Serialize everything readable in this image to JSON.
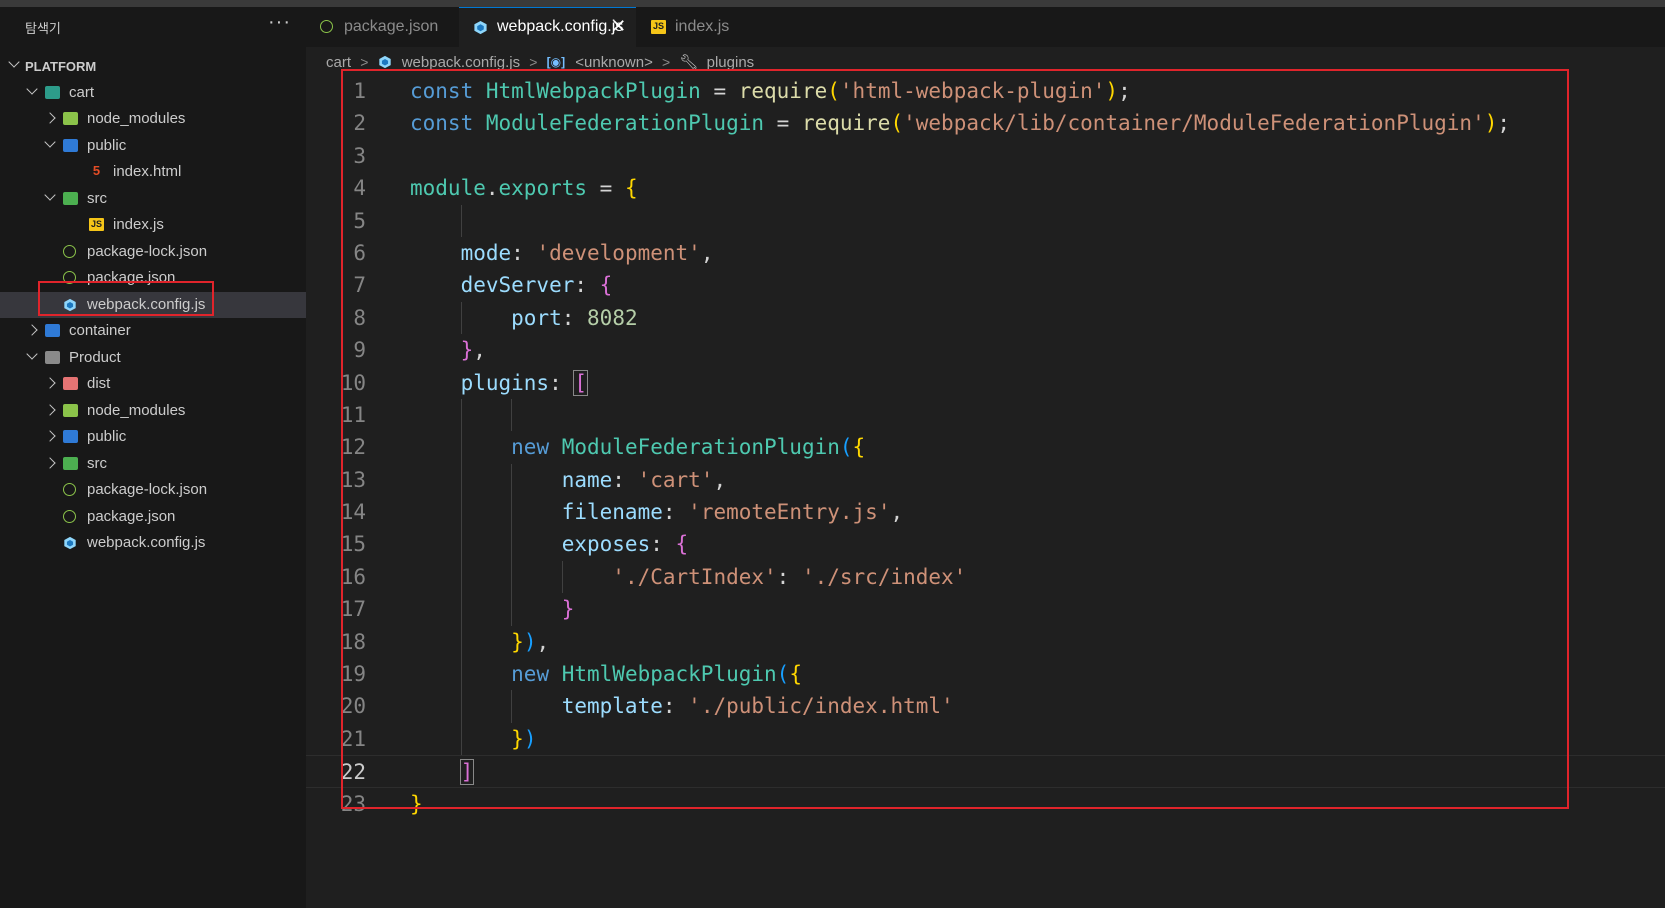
{
  "explorer": {
    "title": "탐색기",
    "more_actions": "···",
    "tree": [
      {
        "label": "PLATFORM",
        "kind": "root",
        "depth": 0,
        "expanded": true
      },
      {
        "label": "cart",
        "kind": "folder-cart",
        "depth": 1,
        "expanded": true
      },
      {
        "label": "node_modules",
        "kind": "folder-node_modules",
        "depth": 2,
        "expanded": false
      },
      {
        "label": "public",
        "kind": "folder-public",
        "depth": 2,
        "expanded": true
      },
      {
        "label": "index.html",
        "kind": "file-html",
        "depth": 3
      },
      {
        "label": "src",
        "kind": "folder-src",
        "depth": 2,
        "expanded": true
      },
      {
        "label": "index.js",
        "kind": "file-js",
        "depth": 3
      },
      {
        "label": "package-lock.json",
        "kind": "file-json",
        "depth": 2
      },
      {
        "label": "package.json",
        "kind": "file-json",
        "depth": 2
      },
      {
        "label": "webpack.config.js",
        "kind": "file-webpack",
        "depth": 2,
        "selected": true
      },
      {
        "label": "container",
        "kind": "folder-container",
        "depth": 1,
        "expanded": false
      },
      {
        "label": "Product",
        "kind": "folder-plain",
        "depth": 1,
        "expanded": true
      },
      {
        "label": "dist",
        "kind": "folder-dist",
        "depth": 2,
        "expanded": false
      },
      {
        "label": "node_modules",
        "kind": "folder-node_modules",
        "depth": 2,
        "expanded": false
      },
      {
        "label": "public",
        "kind": "folder-public",
        "depth": 2,
        "expanded": false
      },
      {
        "label": "src",
        "kind": "folder-src",
        "depth": 2,
        "expanded": false
      },
      {
        "label": "package-lock.json",
        "kind": "file-json",
        "depth": 2
      },
      {
        "label": "package.json",
        "kind": "file-json",
        "depth": 2
      },
      {
        "label": "webpack.config.js",
        "kind": "file-webpack",
        "depth": 2
      }
    ]
  },
  "tabs": [
    {
      "label": "package.json",
      "icon": "json-icon",
      "active": false
    },
    {
      "label": "webpack.config.js",
      "icon": "webpack-icon",
      "active": true,
      "close": "✕"
    },
    {
      "label": "index.js",
      "icon": "js-icon",
      "active": false
    }
  ],
  "breadcrumb": {
    "folder": "cart",
    "file": "webpack.config.js",
    "symbol1": "<unknown>",
    "symbol2": "plugins",
    "separator": ">"
  },
  "editor": {
    "current_line": 22,
    "lines": [
      [
        [
          "kw",
          "const "
        ],
        [
          "cls",
          "HtmlWebpackPlugin"
        ],
        [
          "pl",
          " = "
        ],
        [
          "fn",
          "require"
        ],
        [
          "b1",
          "("
        ],
        [
          "str",
          "'html-webpack-plugin'"
        ],
        [
          "b1",
          ")"
        ],
        [
          "pl",
          ";"
        ]
      ],
      [
        [
          "kw",
          "const "
        ],
        [
          "cls",
          "ModuleFederationPlugin"
        ],
        [
          "pl",
          " = "
        ],
        [
          "fn",
          "require"
        ],
        [
          "b1",
          "("
        ],
        [
          "str",
          "'webpack/lib/container/ModuleFederationPlugin'"
        ],
        [
          "b1",
          ")"
        ],
        [
          "pl",
          ";"
        ]
      ],
      [],
      [
        [
          "cls",
          "module"
        ],
        [
          "pl",
          "."
        ],
        [
          "cls",
          "exports"
        ],
        [
          "pl",
          " = "
        ],
        [
          "b1",
          "{"
        ]
      ],
      [],
      [
        [
          "pl",
          "    "
        ],
        [
          "prop",
          "mode"
        ],
        [
          "pl",
          ": "
        ],
        [
          "str",
          "'development'"
        ],
        [
          "pl",
          ","
        ]
      ],
      [
        [
          "pl",
          "    "
        ],
        [
          "prop",
          "devServer"
        ],
        [
          "pl",
          ": "
        ],
        [
          "b2",
          "{"
        ]
      ],
      [
        [
          "pl",
          "        "
        ],
        [
          "prop",
          "port"
        ],
        [
          "pl",
          ": "
        ],
        [
          "num",
          "8082"
        ]
      ],
      [
        [
          "pl",
          "    "
        ],
        [
          "b2",
          "}"
        ],
        [
          "pl",
          ","
        ]
      ],
      [
        [
          "pl",
          "    "
        ],
        [
          "prop",
          "plugins"
        ],
        [
          "pl",
          ": "
        ],
        [
          "b2",
          "["
        ]
      ],
      [],
      [
        [
          "pl",
          "        "
        ],
        [
          "kw",
          "new "
        ],
        [
          "cls",
          "ModuleFederationPlugin"
        ],
        [
          "b3",
          "("
        ],
        [
          "b1",
          "{"
        ]
      ],
      [
        [
          "pl",
          "            "
        ],
        [
          "prop",
          "name"
        ],
        [
          "pl",
          ": "
        ],
        [
          "str",
          "'cart'"
        ],
        [
          "pl",
          ","
        ]
      ],
      [
        [
          "pl",
          "            "
        ],
        [
          "prop",
          "filename"
        ],
        [
          "pl",
          ": "
        ],
        [
          "str",
          "'remoteEntry.js'"
        ],
        [
          "pl",
          ","
        ]
      ],
      [
        [
          "pl",
          "            "
        ],
        [
          "prop",
          "exposes"
        ],
        [
          "pl",
          ": "
        ],
        [
          "b2",
          "{"
        ]
      ],
      [
        [
          "pl",
          "                "
        ],
        [
          "str",
          "'./CartIndex'"
        ],
        [
          "pl",
          ": "
        ],
        [
          "str",
          "'./src/index'"
        ]
      ],
      [
        [
          "pl",
          "            "
        ],
        [
          "b2",
          "}"
        ]
      ],
      [
        [
          "pl",
          "        "
        ],
        [
          "b1",
          "}"
        ],
        [
          "b3",
          ")"
        ],
        [
          "pl",
          ","
        ]
      ],
      [
        [
          "pl",
          "        "
        ],
        [
          "kw",
          "new "
        ],
        [
          "cls",
          "HtmlWebpackPlugin"
        ],
        [
          "b3",
          "("
        ],
        [
          "b1",
          "{"
        ]
      ],
      [
        [
          "pl",
          "            "
        ],
        [
          "prop",
          "template"
        ],
        [
          "pl",
          ": "
        ],
        [
          "str",
          "'./public/index.html'"
        ]
      ],
      [
        [
          "pl",
          "        "
        ],
        [
          "b1",
          "}"
        ],
        [
          "b3",
          ")"
        ]
      ],
      [
        [
          "pl",
          "    "
        ],
        [
          "b2",
          "]"
        ]
      ],
      [
        [
          "b1",
          "}"
        ]
      ]
    ]
  }
}
